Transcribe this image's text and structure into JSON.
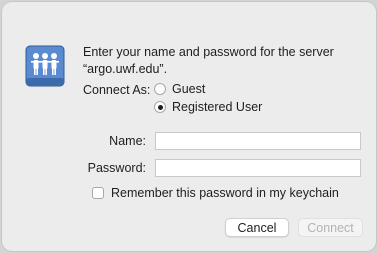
{
  "prompt": {
    "line1": "Enter your name and password for the server",
    "line2": "“argo.uwf.edu”."
  },
  "connect_as": {
    "label": "Connect As:",
    "options": [
      {
        "label": "Guest",
        "selected": false
      },
      {
        "label": "Registered User",
        "selected": true
      }
    ]
  },
  "fields": {
    "name_label": "Name:",
    "name_value": "",
    "password_label": "Password:",
    "password_value": ""
  },
  "remember": {
    "label": "Remember this password in my keychain",
    "checked": false
  },
  "buttons": {
    "cancel": "Cancel",
    "connect": "Connect",
    "connect_enabled": false
  },
  "icon": {
    "name": "shared-server-icon",
    "color": "#4a78b8"
  }
}
